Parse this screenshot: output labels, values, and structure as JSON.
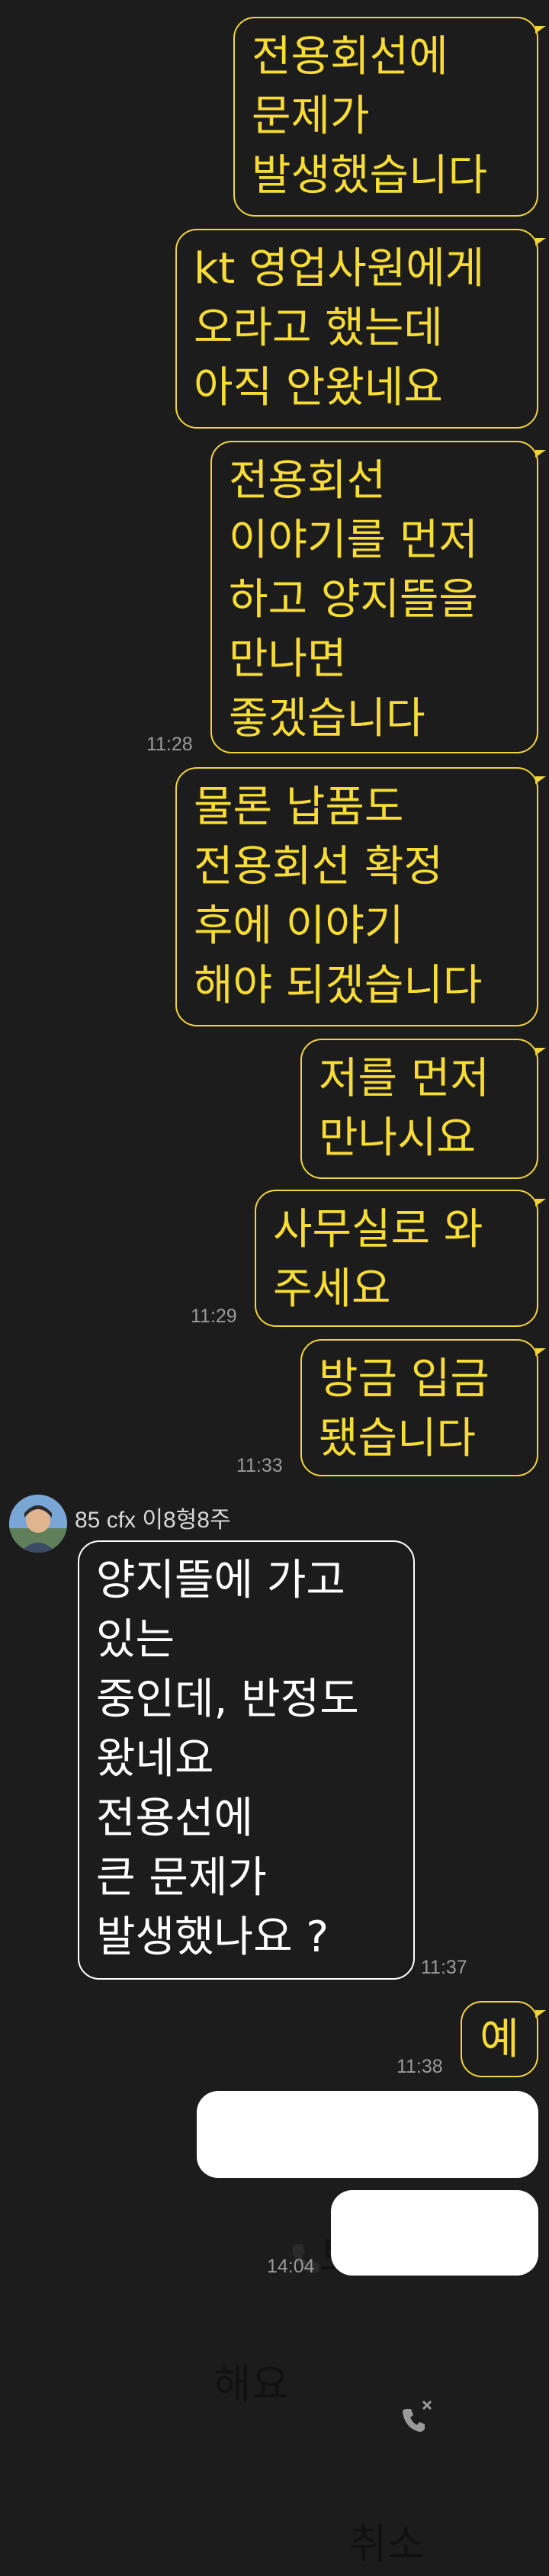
{
  "colors": {
    "background": "#1c1c1c",
    "outgoing_border": "#f2d43a",
    "outgoing_text": "#f7dc35",
    "incoming_border": "#ffffff",
    "timestamp": "#9a9a9a"
  },
  "messages": [
    {
      "text": "전용회선에\n문제가\n발생했습니다"
    },
    {
      "text": "kt 영업사원에게\n오라고 했는데\n아직 안왔네요"
    },
    {
      "text": "전용회선\n이야기를 먼저\n하고 양지뜰을\n만나면\n좋겠습니다",
      "time": "11:28"
    },
    {
      "text": "물론 납품도\n전용회선 확정\n후에 이야기\n해야 되겠습니다"
    },
    {
      "text": "저를 먼저\n만나시요"
    },
    {
      "text": "사무실로 와\n주세요",
      "time": "11:29"
    },
    {
      "text": "방금 입금\n됐습니다",
      "time": "11:33"
    },
    {
      "sender": "85 cfx 이8형8주",
      "text": "양지뜰에 가고\n있는\n중인데, 반정도\n왔네요\n전용선에\n큰 문제가\n발생했나요 ?",
      "time": "11:37"
    },
    {
      "text": "예",
      "time": "11:38"
    },
    {
      "text": "보이스톡 해요",
      "icon": "phone-icon"
    },
    {
      "text": "취소",
      "icon": "phone-cancel-icon",
      "time": "14:04"
    }
  ]
}
